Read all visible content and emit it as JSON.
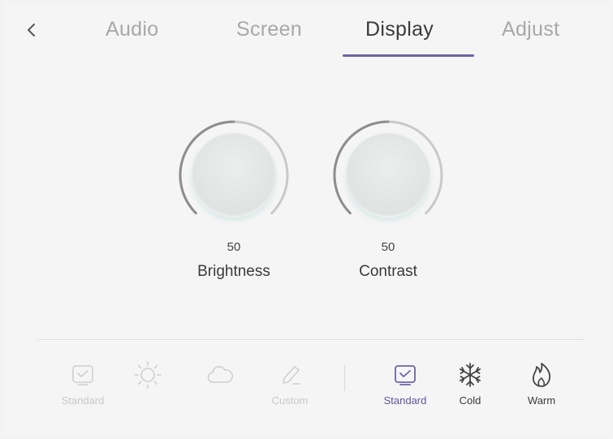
{
  "nav": {
    "back_icon": "chevron-left-icon",
    "tabs": [
      {
        "label": "Audio",
        "active": false
      },
      {
        "label": "Screen",
        "active": false
      },
      {
        "label": "Display",
        "active": true
      },
      {
        "label": "Adjust",
        "active": false
      }
    ]
  },
  "knobs": {
    "brightness": {
      "value": "50",
      "label": "Brightness"
    },
    "contrast": {
      "value": "50",
      "label": "Contrast"
    }
  },
  "picture_modes": {
    "items": [
      {
        "icon": "monitor-check-icon",
        "label": "Standard",
        "state": "disabled"
      },
      {
        "icon": "sun-icon",
        "label": "",
        "state": "disabled"
      },
      {
        "icon": "cloud-icon",
        "label": "",
        "state": "disabled"
      },
      {
        "icon": "pen-icon",
        "label": "Custom",
        "state": "disabled"
      }
    ]
  },
  "color_temperature": {
    "items": [
      {
        "icon": "monitor-check-icon",
        "label": "Standard",
        "state": "selected"
      },
      {
        "icon": "snowflake-icon",
        "label": "Cold",
        "state": "enabled"
      },
      {
        "icon": "flame-icon",
        "label": "Warm",
        "state": "enabled"
      }
    ]
  },
  "colors": {
    "accent": "#6d62a8",
    "accent_text": "#5e56a0",
    "disabled": "#c8c8c8",
    "background": "#f5f5f5"
  }
}
